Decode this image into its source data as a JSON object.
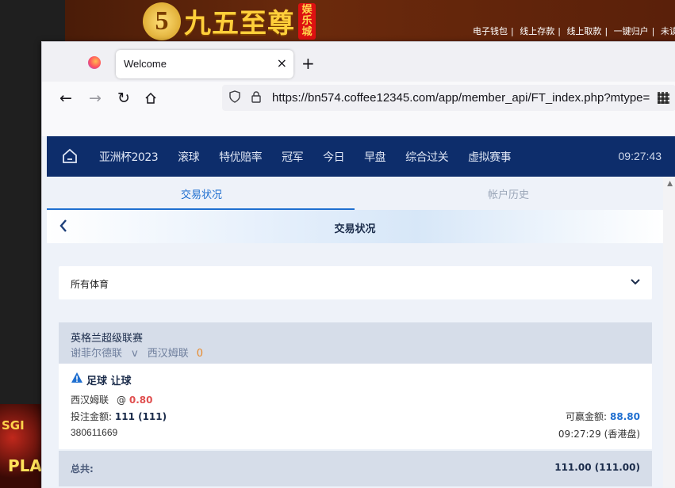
{
  "background_site": {
    "logo_text": "九五至尊",
    "logo_badge": "娱乐城",
    "top_links": [
      "电子钱包",
      "线上存款",
      "线上取款",
      "一键归户",
      "未读讯"
    ],
    "side_text": [
      "SGI",
      "PLA"
    ]
  },
  "browser": {
    "tab_title": "Welcome",
    "tab_close": "×",
    "new_tab": "+",
    "url": "https://bn574.coffee12345.com/app/member_api/FT_index.php?mtype="
  },
  "topnav": {
    "items": [
      "亚洲杯2023",
      "滚球",
      "特优赔率",
      "冠军",
      "今日",
      "早盘",
      "综合过关",
      "虚拟赛事"
    ],
    "time": "09:27:43"
  },
  "subtabs": {
    "active": "交易状况",
    "inactive": "帐户历史"
  },
  "page_title": "交易状况",
  "sport_filter": {
    "selected": "所有体育"
  },
  "bet": {
    "league": "英格兰超级联赛",
    "home_team": "谢菲尔德联",
    "vs": "v",
    "away_team": "西汉姆联",
    "score": "0",
    "bet_type": "足球 让球",
    "pick": "西汉姆联",
    "odds_prefix": "@",
    "odds": "0.80",
    "stake_label": "投注金额:",
    "stake_value": "111 (111)",
    "payout_label": "可赢金额:",
    "payout_value": "88.80",
    "ticket_id": "380611669",
    "bet_time": "09:27:29 (香港盘)"
  },
  "total": {
    "label": "总共:",
    "value": "111.00 (111.00)"
  },
  "colors": {
    "nav_bg": "#0d2d6b",
    "accent_blue": "#1f6fd0",
    "odds_red": "#e05050",
    "score_orange": "#e8892a"
  }
}
